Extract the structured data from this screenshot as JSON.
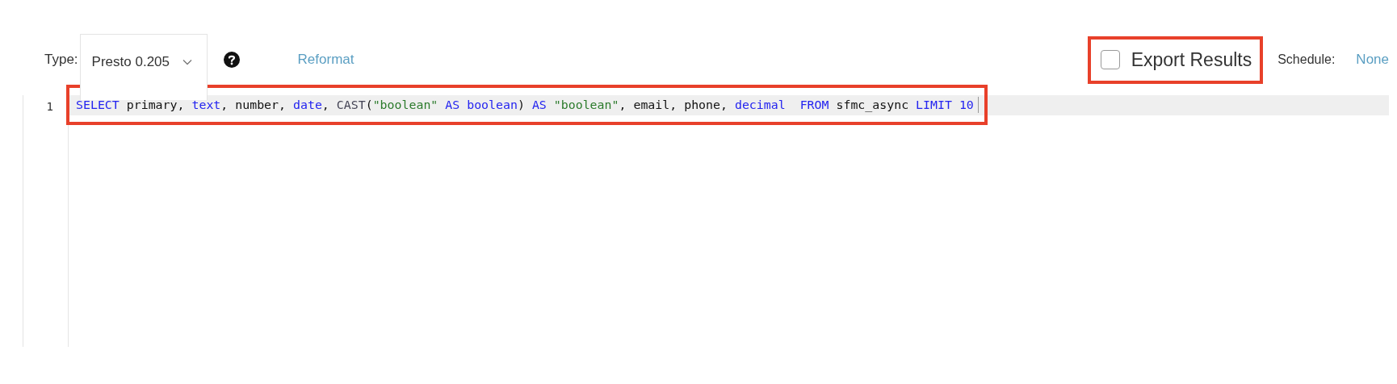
{
  "toolbar": {
    "type_label": "Type:",
    "type_value": "Presto 0.205",
    "reformat": "Reformat",
    "export": {
      "label": "Export Results",
      "checked": false,
      "highlighted": true
    },
    "schedule_label": "Schedule:",
    "schedule_value": "None"
  },
  "editor": {
    "lines": [
      {
        "number": "1",
        "highlighted": true,
        "tokens": [
          {
            "kind": "keyword",
            "text": "SELECT"
          },
          {
            "kind": "plain",
            "text": " primary, "
          },
          {
            "kind": "keyword",
            "text": "text"
          },
          {
            "kind": "plain",
            "text": ", number, "
          },
          {
            "kind": "keyword",
            "text": "date"
          },
          {
            "kind": "plain",
            "text": ", "
          },
          {
            "kind": "function",
            "text": "CAST"
          },
          {
            "kind": "plain",
            "text": "("
          },
          {
            "kind": "string",
            "text": "\"boolean\""
          },
          {
            "kind": "keyword",
            "text": " AS boolean"
          },
          {
            "kind": "plain",
            "text": ") "
          },
          {
            "kind": "keyword",
            "text": "AS"
          },
          {
            "kind": "string",
            "text": " \"boolean\""
          },
          {
            "kind": "plain",
            "text": ", email, phone, "
          },
          {
            "kind": "keyword",
            "text": "decimal"
          },
          {
            "kind": "keyword",
            "text": "  FROM"
          },
          {
            "kind": "plain",
            "text": " sfmc_async "
          },
          {
            "kind": "keyword",
            "text": "LIMIT 10"
          }
        ]
      }
    ]
  }
}
